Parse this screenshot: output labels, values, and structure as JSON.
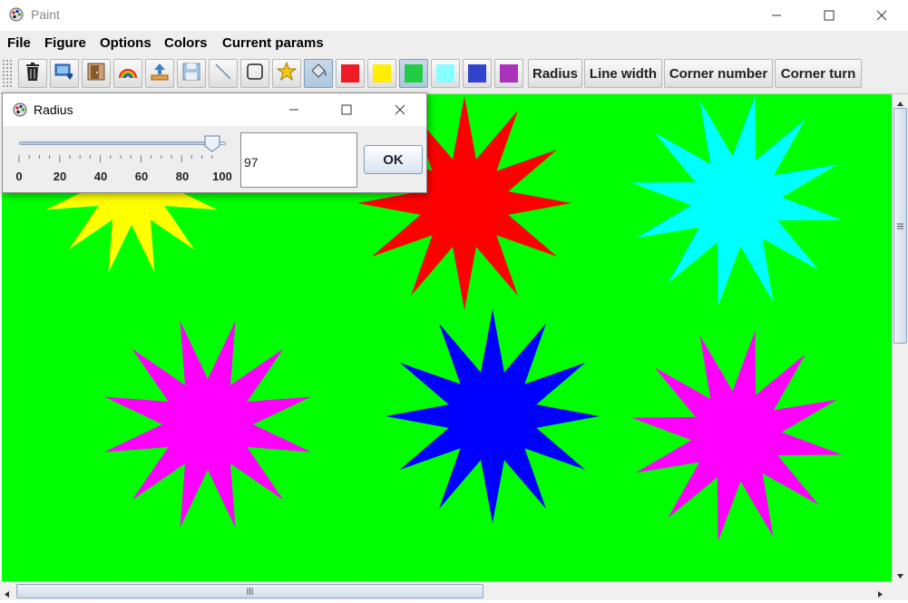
{
  "window": {
    "title": "Paint",
    "icon": "paint-palette-icon"
  },
  "menu": [
    "File",
    "Figure",
    "Options",
    "Colors",
    "Current params"
  ],
  "toolbar": {
    "icons": [
      "trash-icon",
      "export-icon",
      "exit-door-icon",
      "rainbow-icon",
      "upload-icon",
      "save-disk-icon",
      "line-icon",
      "rectangle-icon",
      "star-icon",
      "paint-bucket-icon"
    ],
    "pressed_icon": "paint-bucket-icon",
    "swatches": [
      "#ee1c24",
      "#ffee00",
      "#22cc44",
      "#88ffff",
      "#3344cc",
      "#aa33bb"
    ],
    "selected_swatch": "#22cc44",
    "text_buttons": [
      "Radius",
      "Line width",
      "Corner number",
      "Corner turn"
    ]
  },
  "canvas": {
    "background": "#00ff00",
    "stars": [
      {
        "color": "#ffff00",
        "points": 12
      },
      {
        "color": "#ff0000",
        "points": 12
      },
      {
        "color": "#00ffff",
        "points": 12
      },
      {
        "color": "#ff00ff",
        "points": 12
      },
      {
        "color": "#0000ff",
        "points": 12
      },
      {
        "color": "#ff00ff",
        "points": 12
      }
    ]
  },
  "dialog": {
    "title": "Radius",
    "slider": {
      "min": 0,
      "max": 100,
      "value": 97,
      "labels": [
        "0",
        "20",
        "40",
        "60",
        "80",
        "100"
      ]
    },
    "value": "97",
    "ok_label": "OK"
  }
}
